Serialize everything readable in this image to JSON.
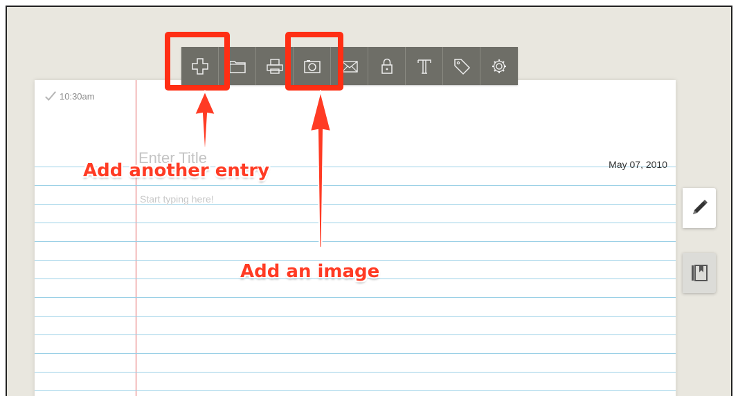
{
  "toolbar": {
    "buttons": [
      {
        "icon": "plus-icon"
      },
      {
        "icon": "folder-icon"
      },
      {
        "icon": "printer-icon"
      },
      {
        "icon": "camera-icon"
      },
      {
        "icon": "mail-icon"
      },
      {
        "icon": "lock-icon"
      },
      {
        "icon": "text-icon"
      },
      {
        "icon": "tag-icon"
      },
      {
        "icon": "gear-icon"
      }
    ]
  },
  "entry": {
    "time": "10:30am",
    "title_placeholder": "Enter Title",
    "date": "May 07, 2010",
    "body_placeholder": "Start typing here!"
  },
  "side_tabs": [
    {
      "icon": "pencil-icon"
    },
    {
      "icon": "bookmark-icon"
    }
  ],
  "annotations": {
    "add_entry": "Add another entry",
    "add_image": "Add an image"
  },
  "colors": {
    "toolbar_bg": "#6e6e67",
    "annotation": "#ff3b24",
    "ruled_line": "#9ad0e6",
    "margin_line": "#e25252",
    "background": "#e9e7df"
  }
}
